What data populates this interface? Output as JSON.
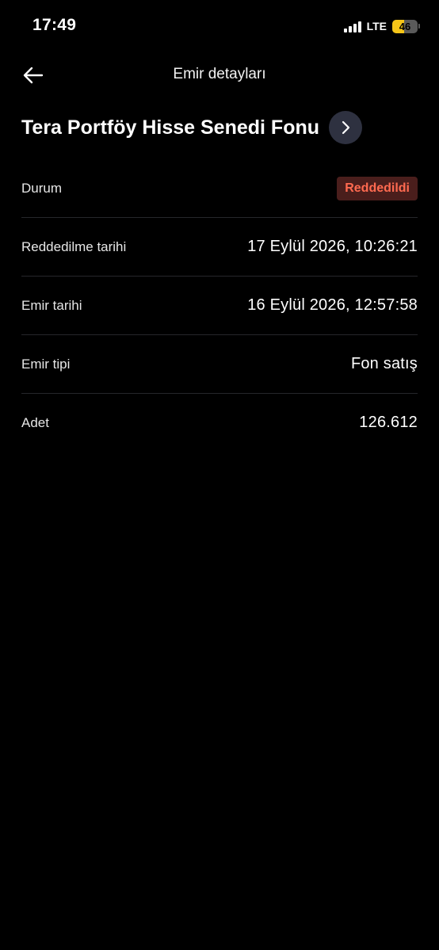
{
  "status_bar": {
    "time": "17:49",
    "network": "LTE",
    "battery": "46",
    "battery_level": 0.46,
    "battery_color": "#f5c518"
  },
  "header": {
    "title": "Emir detayları",
    "back_icon": "arrow-left-icon"
  },
  "fund": {
    "name": "Tera Portföy Hisse Senedi Fonu",
    "go_icon": "chevron-right-icon"
  },
  "details": {
    "status": {
      "label": "Durum",
      "value": "Reddedildi",
      "badge_color": "#ff6a50"
    },
    "rejected_date": {
      "label": "Reddedilme tarihi",
      "value": "17 Eylül 2026, 10:26:21"
    },
    "order_date": {
      "label": "Emir tarihi",
      "value": "16 Eylül 2026, 12:57:58"
    },
    "order_type": {
      "label": "Emir tipi",
      "value": "Fon satış"
    },
    "quantity": {
      "label": "Adet",
      "value": "126.612"
    }
  }
}
